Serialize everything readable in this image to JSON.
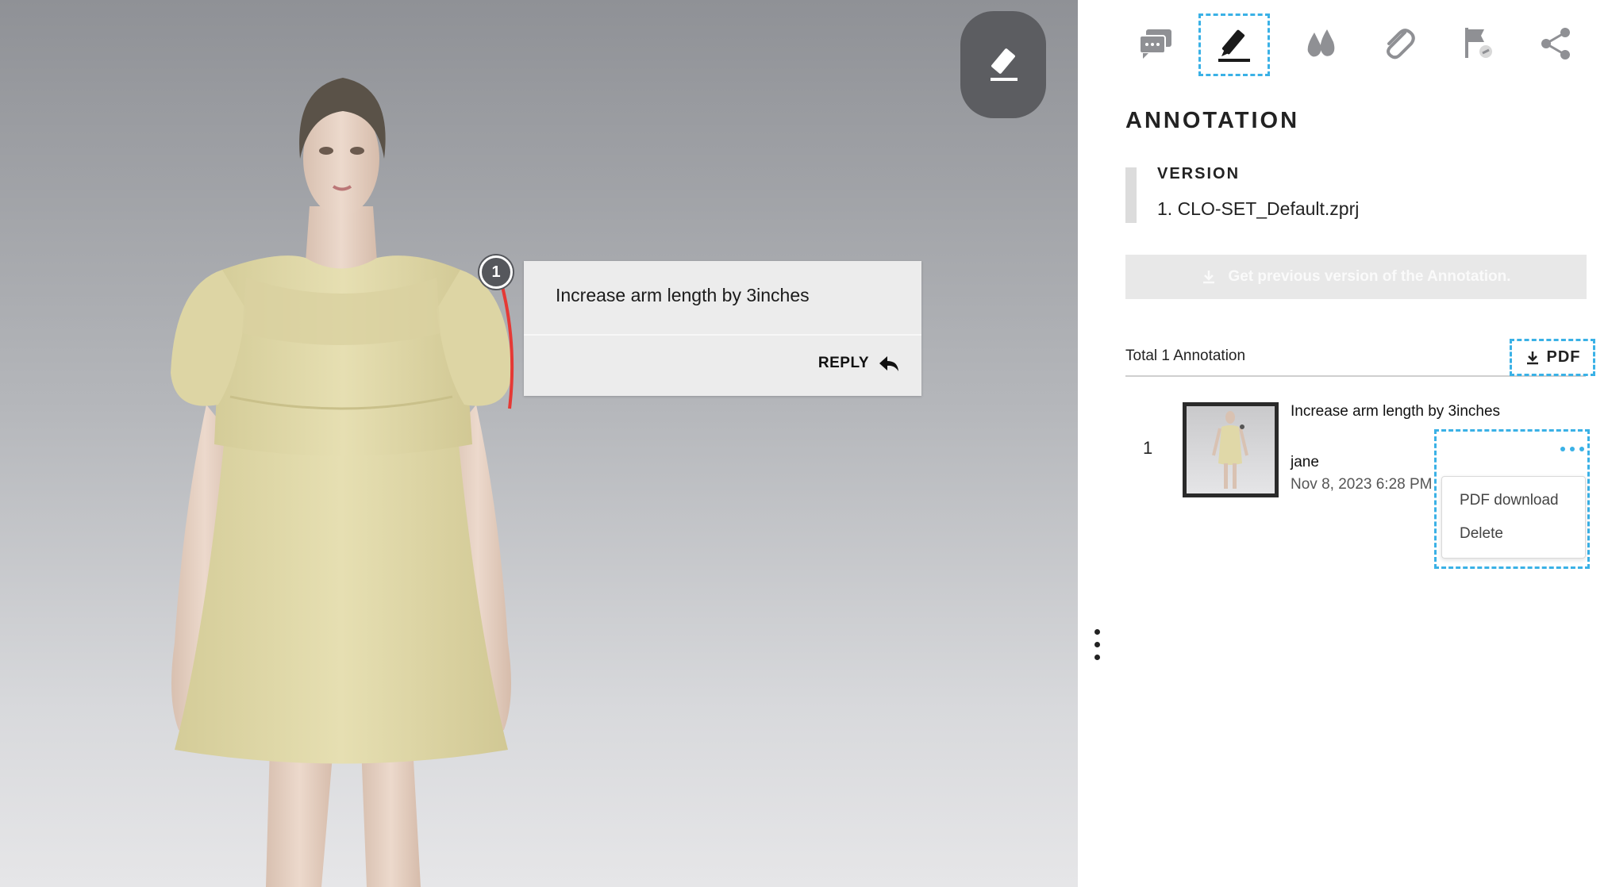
{
  "viewport": {
    "eraser_icon": "eraser-icon",
    "pin_number": "1",
    "note": {
      "text": "Increase arm length by 3inches",
      "reply_label": "REPLY",
      "reply_icon": "reply-arrow-icon"
    }
  },
  "toolbar": {
    "tabs": [
      {
        "name": "comments",
        "icon": "chat-bubbles-icon"
      },
      {
        "name": "annotation",
        "icon": "pen-icon",
        "active": true
      },
      {
        "name": "colorways",
        "icon": "droplets-icon"
      },
      {
        "name": "attachments",
        "icon": "paperclip-icon"
      },
      {
        "name": "linked-annotation",
        "icon": "flag-link-icon"
      },
      {
        "name": "share",
        "icon": "share-icon"
      }
    ]
  },
  "panel": {
    "title": "ANNOTATION",
    "version": {
      "label": "VERSION",
      "value": "1. CLO-SET_Default.zprj"
    },
    "prev_version_button": "Get previous version of the Annotation.",
    "total_label": "Total 1 Annotation",
    "pdf_button": "PDF",
    "annotations": [
      {
        "index": "1",
        "text": "Increase arm length by 3inches",
        "author": "jane",
        "date": "Nov 8, 2023 6:28 PM"
      }
    ],
    "context_menu": {
      "items": [
        "PDF download",
        "Delete"
      ]
    }
  },
  "colors": {
    "accent_dashed": "#3ab1e6",
    "marker_line": "#e53935",
    "dress": "#e3dcae"
  }
}
